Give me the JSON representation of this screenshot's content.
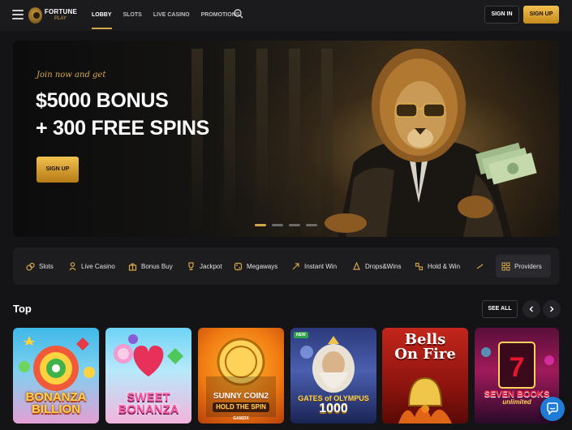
{
  "header": {
    "logo_line1": "FORTUNE",
    "logo_line2": "PLAY",
    "nav": [
      {
        "label": "LOBBY",
        "active": true
      },
      {
        "label": "SLOTS",
        "active": false
      },
      {
        "label": "LIVE CASINO",
        "active": false
      },
      {
        "label": "PROMOTIONS",
        "active": false
      }
    ],
    "sign_in": "SIGN IN",
    "sign_up": "SIGN UP"
  },
  "banner": {
    "small_text": "Join now and get",
    "big_line1": "$5000 BONUS",
    "big_line2": "+ 300 FREE SPINS",
    "cta": "SIGN UP",
    "slides": 4,
    "active_slide": 1
  },
  "categories": [
    {
      "label": "Slots",
      "icon": "slots-icon"
    },
    {
      "label": "Live Casino",
      "icon": "live-casino-icon"
    },
    {
      "label": "Bonus Buy",
      "icon": "bonus-buy-icon"
    },
    {
      "label": "Jackpot",
      "icon": "jackpot-icon"
    },
    {
      "label": "Megaways",
      "icon": "megaways-icon"
    },
    {
      "label": "Instant Win",
      "icon": "instant-win-icon"
    },
    {
      "label": "Drops&Wins",
      "icon": "drops-wins-icon"
    },
    {
      "label": "Hold & Win",
      "icon": "hold-win-icon"
    }
  ],
  "providers_label": "Providers",
  "top_section": {
    "title": "Top",
    "see_all": "SEE ALL"
  },
  "games": [
    {
      "title_line1": "BONANZA",
      "title_line2": "BILLION",
      "badge": ""
    },
    {
      "title_line1": "SWEET",
      "title_line2": "BONANZA",
      "badge": ""
    },
    {
      "title_line1": "SUNNY COIN2",
      "title_line2": "HOLD THE SPIN",
      "sub": "GAMZIX",
      "badge": ""
    },
    {
      "title_line1": "GATES of OLYMPUS",
      "title_line2": "1000",
      "badge": "NEW"
    },
    {
      "title_line1": "Bells",
      "title_line2": "On Fire",
      "badge": ""
    },
    {
      "title_line1": "SEVEN BOOKS",
      "title_line2": "unlimited",
      "badge": ""
    }
  ],
  "colors": {
    "accent_gold": "#d4a646",
    "background": "#141416",
    "chat_blue": "#1e7bd6"
  }
}
